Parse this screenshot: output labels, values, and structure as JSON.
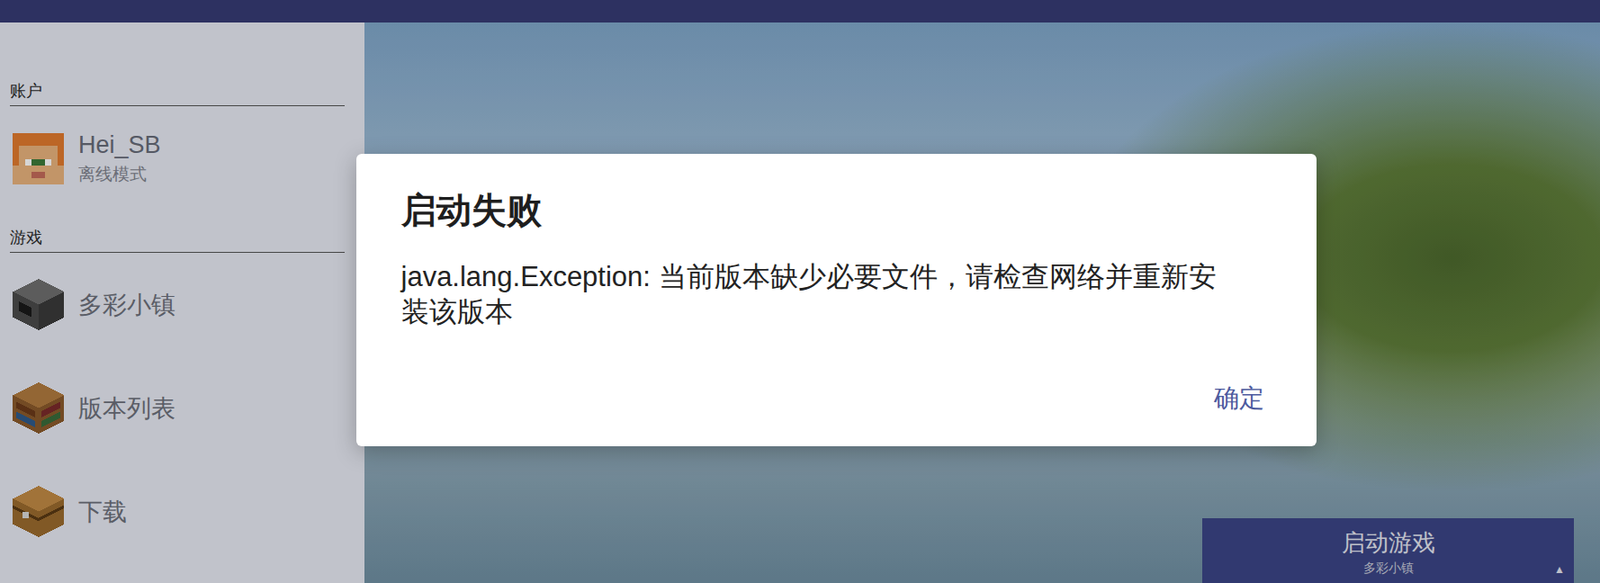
{
  "account": {
    "section": "账户",
    "name": "Hei_SB",
    "mode": "离线模式"
  },
  "game": {
    "section": "游戏",
    "items": [
      {
        "label": "多彩小镇",
        "kind": "instance"
      },
      {
        "label": "版本列表",
        "kind": "versions"
      },
      {
        "label": "下载",
        "kind": "download"
      }
    ]
  },
  "launch_button": {
    "label": "启动游戏",
    "subtitle": "多彩小镇",
    "arrow": "▲"
  },
  "dialog": {
    "title": "启动失败",
    "message": "java.lang.Exception: 当前版本缺少必要文件，请检查网络并重新安装该版本",
    "buttons": [
      "确定"
    ]
  }
}
